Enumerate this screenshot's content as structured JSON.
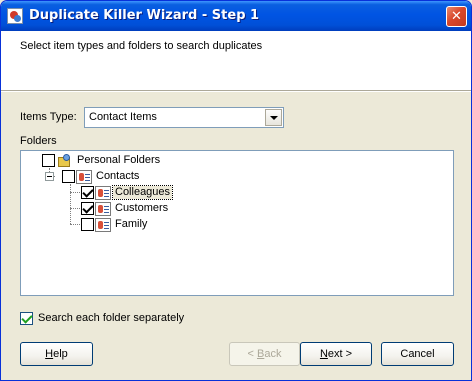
{
  "window": {
    "title": "Duplicate Killer Wizard - Step 1",
    "close_glyph": "✕"
  },
  "header": {
    "instruction": "Select item types and folders to search duplicates"
  },
  "items_type": {
    "label": "Items Type:",
    "selected": "Contact Items"
  },
  "folders": {
    "label": "Folders",
    "tree": [
      {
        "label": "Personal Folders",
        "checked": false,
        "icon": "personal-folders-icon"
      },
      {
        "label": "Contacts",
        "checked": false,
        "icon": "contacts-folder-icon",
        "expanded": true
      },
      {
        "label": "Colleagues",
        "checked": true,
        "icon": "contacts-folder-icon",
        "selected": true
      },
      {
        "label": "Customers",
        "checked": true,
        "icon": "contacts-folder-icon"
      },
      {
        "label": "Family",
        "checked": false,
        "icon": "contacts-folder-icon"
      }
    ]
  },
  "options": {
    "search_separately_label": "Search each folder separately",
    "search_separately_checked": true
  },
  "buttons": {
    "help": {
      "pre": "",
      "key": "H",
      "post": "elp"
    },
    "back": {
      "pre": "< ",
      "key": "B",
      "post": "ack"
    },
    "next": {
      "pre": "",
      "key": "N",
      "post": "ext >"
    },
    "cancel": {
      "label": "Cancel"
    }
  }
}
